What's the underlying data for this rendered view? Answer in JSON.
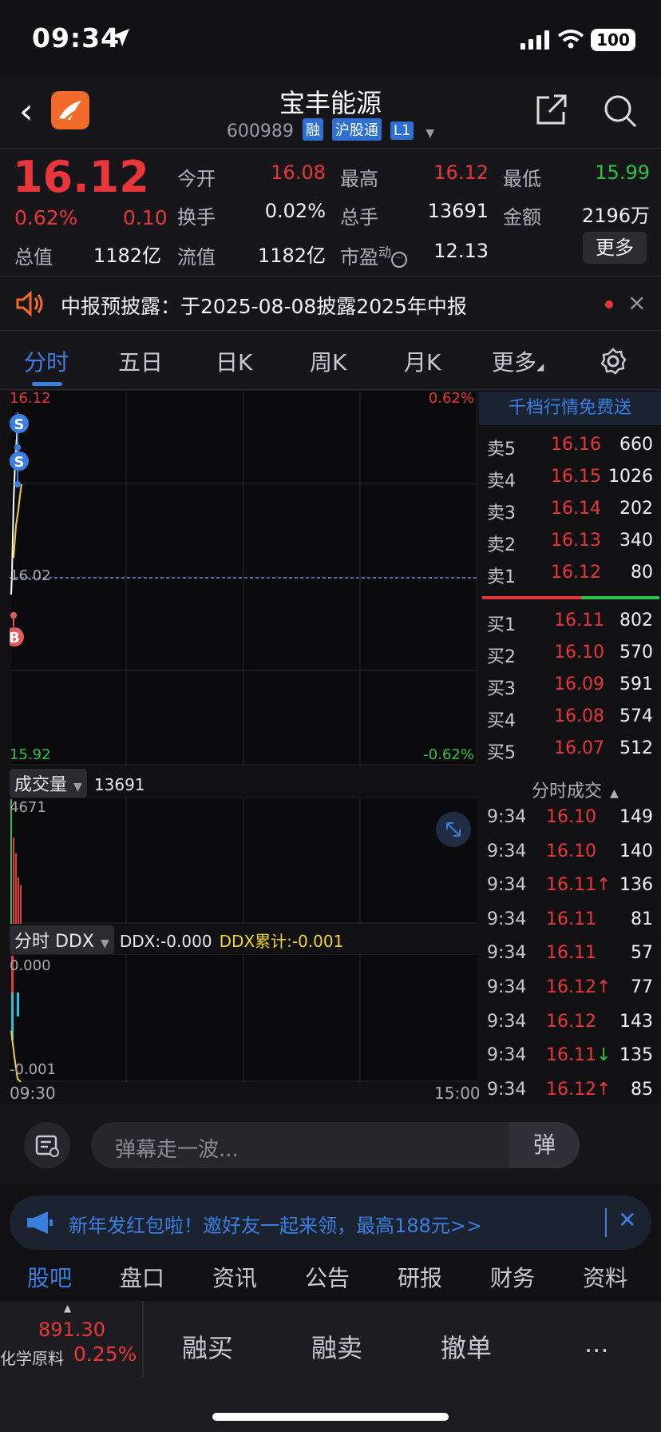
{
  "status_bar": {
    "time": "09:34",
    "battery": "100"
  },
  "header": {
    "stock_name": "宝丰能源",
    "code": "600989",
    "tags": [
      "融",
      "沪股通",
      "L1"
    ]
  },
  "quote": {
    "price": "16.12",
    "change_pct": "0.62%",
    "change_abs": "0.10",
    "total_value_label": "总值",
    "total_value": "1182亿",
    "open_label": "今开",
    "open": "16.08",
    "high_label": "最高",
    "high": "16.12",
    "low_label": "最低",
    "low": "15.99",
    "turnover_label": "换手",
    "turnover": "0.02%",
    "volume_label": "总手",
    "volume": "13691",
    "amount_label": "金额",
    "amount": "2196万",
    "float_label": "流值",
    "float_value": "1182亿",
    "pe_label": "市盈",
    "pe_sup": "动",
    "pe": "12.13",
    "more_label": "更多"
  },
  "notice": {
    "text": "中报预披露：于2025-08-08披露2025年中报",
    "close": "×"
  },
  "tabs": [
    "分时",
    "五日",
    "日K",
    "周K",
    "月K",
    "更多"
  ],
  "chart": {
    "top_price": "16.12",
    "top_pct": "0.62%",
    "mid_price": "16.02",
    "bottom_price": "15.92",
    "bottom_pct": "-0.62%",
    "markers": [
      "S",
      "S",
      "B"
    ]
  },
  "volume_panel": {
    "selector": "成交量",
    "value": "13691",
    "max": "4671"
  },
  "ddx_panel": {
    "selector": "分时 DDX",
    "ddx": "DDX:-0.000",
    "ddx_cum": "DDX累计:-0.001",
    "top": "0.000",
    "bottom": "-0.001",
    "time_start": "09:30",
    "time_end": "15:00"
  },
  "order_book": {
    "banner": "千档行情免费送",
    "sells": [
      {
        "label": "卖5",
        "price": "16.16",
        "vol": "660"
      },
      {
        "label": "卖4",
        "price": "16.15",
        "vol": "1026"
      },
      {
        "label": "卖3",
        "price": "16.14",
        "vol": "202"
      },
      {
        "label": "卖2",
        "price": "16.13",
        "vol": "340"
      },
      {
        "label": "卖1",
        "price": "16.12",
        "vol": "80"
      }
    ],
    "buys": [
      {
        "label": "买1",
        "price": "16.11",
        "vol": "802"
      },
      {
        "label": "买2",
        "price": "16.10",
        "vol": "570"
      },
      {
        "label": "买3",
        "price": "16.09",
        "vol": "591"
      },
      {
        "label": "买4",
        "price": "16.08",
        "vol": "574"
      },
      {
        "label": "买5",
        "price": "16.07",
        "vol": "512"
      }
    ],
    "ticks_title": "分时成交",
    "ticks": [
      {
        "time": "9:34",
        "price": "16.10",
        "arrow": "",
        "vol": "149",
        "dir": "red"
      },
      {
        "time": "9:34",
        "price": "16.10",
        "arrow": "",
        "vol": "140",
        "dir": "red"
      },
      {
        "time": "9:34",
        "price": "16.11",
        "arrow": "↑",
        "vol": "136",
        "dir": "red"
      },
      {
        "time": "9:34",
        "price": "16.11",
        "arrow": "",
        "vol": "81",
        "dir": "red"
      },
      {
        "time": "9:34",
        "price": "16.11",
        "arrow": "",
        "vol": "57",
        "dir": "red"
      },
      {
        "time": "9:34",
        "price": "16.12",
        "arrow": "↑",
        "vol": "77",
        "dir": "red"
      },
      {
        "time": "9:34",
        "price": "16.12",
        "arrow": "",
        "vol": "143",
        "dir": "red"
      },
      {
        "time": "9:34",
        "price": "16.11",
        "arrow": "↓",
        "vol": "135",
        "dir": "green"
      },
      {
        "time": "9:34",
        "price": "16.12",
        "arrow": "↑",
        "vol": "85",
        "dir": "red"
      }
    ]
  },
  "danmu": {
    "placeholder": "弹幕走一波...",
    "button": "弹"
  },
  "promo": {
    "text": "新年发红包啦！邀好友一起来领，最高188元>>"
  },
  "bottom_tabs": [
    "股吧",
    "盘口",
    "资讯",
    "公告",
    "研报",
    "财务",
    "资料"
  ],
  "action_bar": {
    "sector_value": "891.30",
    "sector_name": "化学原料",
    "sector_pct": "0.25%",
    "actions": [
      "融买",
      "融卖",
      "撤单",
      "..."
    ]
  },
  "colors": {
    "up": "#e8363a",
    "down": "#2fc24a",
    "accent": "#3a7fe0"
  }
}
